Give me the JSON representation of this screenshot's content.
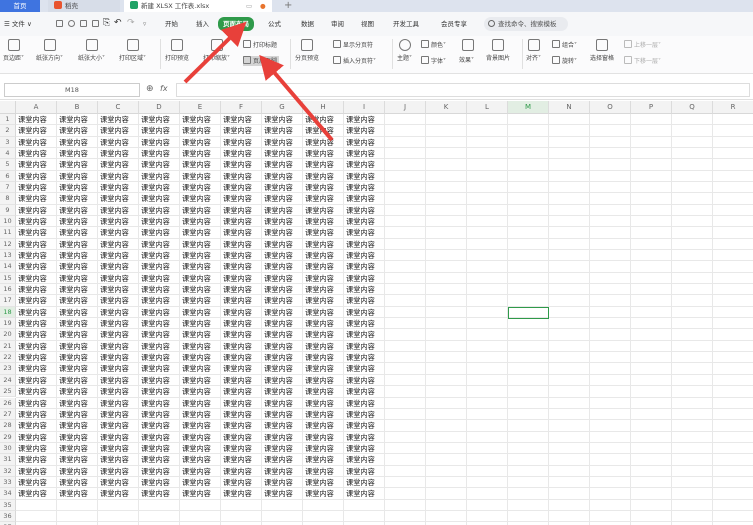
{
  "titlebar": {
    "home_tab": "首页",
    "tab2": "稻壳",
    "tab3": "新建 XLSX 工作表.xlsx",
    "new_tab": "+"
  },
  "menu": {
    "file": "文件",
    "items": [
      "开始",
      "插入",
      "页面布局",
      "公式",
      "数据",
      "审阅",
      "视图",
      "开发工具",
      "会员专享"
    ],
    "active": "页面布局",
    "search": "查找命令、搜索模板"
  },
  "ribbon": {
    "margins": "页边距",
    "orientation": "纸张方向",
    "size": "纸张大小",
    "print_area": "打印区域",
    "print_preview": "打印预览",
    "print_scale": "打印缩放",
    "print_titles": "打印标题",
    "header_footer": "页眉页脚",
    "page_break_preview": "分页预览",
    "show_page_breaks": "显示分页符",
    "insert_page_break": "插入分页符",
    "theme": "主题",
    "colors": "颜色",
    "fonts": "字体",
    "effects": "效果",
    "background": "背景图片",
    "align": "对齐",
    "group": "组合",
    "rotate": "旋转",
    "selection_pane": "选择窗格",
    "bring_forward": "上移一层",
    "send_backward": "下移一层"
  },
  "formula_bar": {
    "name_box": "M18",
    "fx": "fx",
    "formula": ""
  },
  "sheet": {
    "columns": [
      "A",
      "B",
      "C",
      "D",
      "E",
      "F",
      "G",
      "H",
      "I",
      "J",
      "K",
      "L",
      "M",
      "N",
      "O",
      "P",
      "Q",
      "R"
    ],
    "active_column": "M",
    "active_row": 18,
    "filled_rows": 34,
    "filled_cols": 9,
    "cell_text": "课堂内容",
    "row_count": 37
  },
  "colors": {
    "active_tab": "#2f9a4a",
    "arrow": "#e8403a",
    "selection": "#2f9a4a",
    "home_tab": "#3f74e0"
  }
}
